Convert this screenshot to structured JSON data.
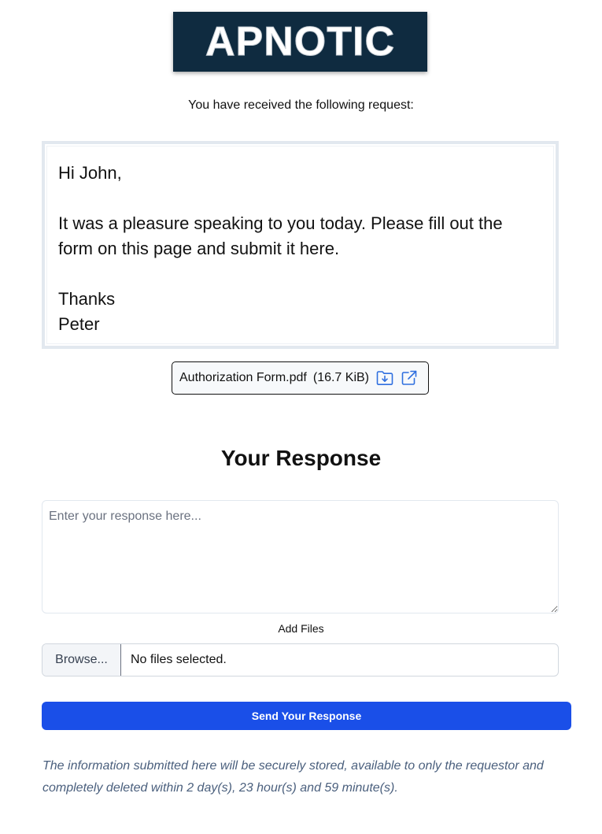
{
  "logo": {
    "text": "APNOTIC"
  },
  "intro": {
    "text": "You have received the following request:"
  },
  "message": {
    "greeting": "Hi John,",
    "body": "It was a pleasure speaking to you today.  Please fill out the form on this page and submit it here.",
    "signoff": "Thanks\nPeter"
  },
  "attachment": {
    "filename": "Authorization Form.pdf",
    "size": "(16.7 KiB)",
    "download_icon": "folder-download-icon",
    "open_icon": "external-link-icon"
  },
  "response": {
    "title": "Your Response",
    "placeholder": "Enter your response here...",
    "value": ""
  },
  "files": {
    "label": "Add Files",
    "browse_label": "Browse...",
    "status": "No files selected."
  },
  "send": {
    "label": "Send Your Response"
  },
  "notice": {
    "text": "The information submitted here will be securely stored, available to only the requestor and completely deleted within 2 day(s), 23 hour(s) and 59 minute(s)."
  },
  "colors": {
    "logo_bg": "#0f2b40",
    "accent": "#1a4fe8",
    "notice_text": "#4a5f7d",
    "icon_blue": "#2f6fdf"
  }
}
